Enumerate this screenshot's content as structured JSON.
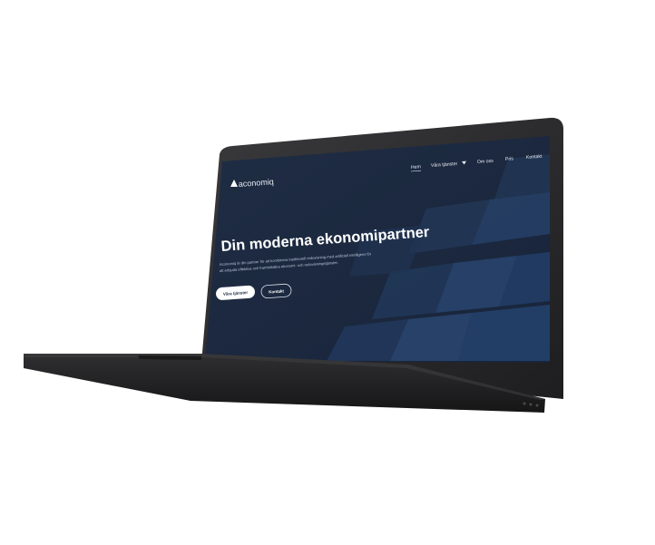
{
  "site": {
    "logo_text": "aconomiq",
    "nav": {
      "items": [
        "Hem",
        "Våra tjänster",
        "Om oss",
        "Pris",
        "Kontakt"
      ],
      "active": "Hem"
    },
    "hero": {
      "title": "Din moderna ekonomipartner",
      "subtitle_line1": "Aconomiq är din partner för att kombinera traditionell redovisning med artificiell intelligens för",
      "subtitle_line2": "att erbjuda effektiva och framtidsäkra ekonomi- och redovisningstjänster.",
      "primary_button": "Våra tjänster",
      "secondary_button": "Kontakt"
    }
  },
  "colors": {
    "screen_background": "#1c2a40",
    "laptop_body": "#2a2a2c",
    "accent_pattern": "#25426b",
    "button_primary_bg": "#ffffff",
    "button_primary_text": "#1c2a40"
  },
  "icons": {
    "logo_mark": "triangle-logo-icon",
    "nav_dropdown": "caret-down-icon"
  }
}
